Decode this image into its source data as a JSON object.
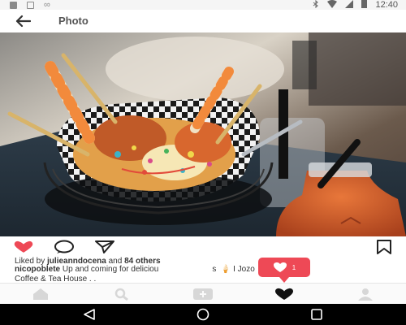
{
  "status_bar": {
    "time": "12:40",
    "icons": [
      "notification-square-icon",
      "notification-box-icon",
      "infinity-icon",
      "bluetooth-icon",
      "wifi-icon",
      "signal-icon",
      "battery-icon"
    ]
  },
  "header": {
    "title": "Photo",
    "back_icon": "arrow-left-icon"
  },
  "post": {
    "photo_alt": "Dessert in checkered paper cone with wafer sticks and drink",
    "likes_prefix": "Liked by ",
    "liked_by": "julieanndocena",
    "likes_joiner": " and ",
    "others": "84 others",
    "caption_user": "nicopoblete",
    "caption_text_a": " Up and coming for deliciou",
    "caption_text_b": "s  🍦 I Jozo",
    "caption_line2": "Coffee & Tea House . ."
  },
  "notification": {
    "count": "1",
    "icon": "heart-icon"
  },
  "actions": {
    "like_icon": "heart-filled-icon",
    "comment_icon": "comment-icon",
    "share_icon": "send-icon",
    "save_icon": "bookmark-icon"
  },
  "tab_bar": {
    "tabs": [
      "home-icon",
      "search-icon",
      "add-post-icon",
      "activity-heart-icon",
      "profile-icon"
    ],
    "active": "activity-heart-icon"
  },
  "colors": {
    "like_red": "#ee4956",
    "text_dark": "#333333",
    "nav_black": "#000000"
  }
}
